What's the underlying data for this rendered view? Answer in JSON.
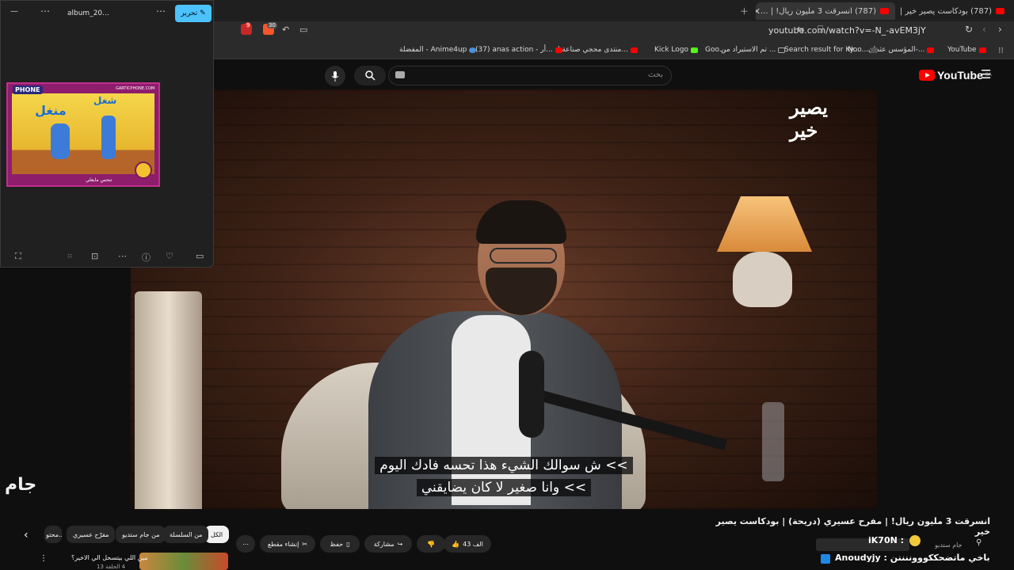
{
  "browser": {
    "tabs": [
      {
        "label": "(787) انسرقت 3 مليون ريال! | ...",
        "active": true
      },
      {
        "label": "(787) بودكاست يصير خير | ما أقدر أقول...",
        "active": false
      }
    ],
    "url": "youtube.com/watch?v=-N_-avEM3jY",
    "ext_badge_1": "9",
    "ext_badge_2": "30",
    "bookmarks": [
      {
        "label": "YouTube",
        "color": "#ff0000"
      },
      {
        "label": "المؤسس عثمان-...",
        "color": "#ff0000"
      },
      {
        "label": "Noo...",
        "color": "#555555"
      },
      {
        "label": "Search result for Ky...",
        "color": "#777777"
      },
      {
        "label": "تم الاستيراد من ...",
        "color": "#888888"
      },
      {
        "label": "Goo...",
        "color": "#888888"
      },
      {
        "label": "Kick Logo",
        "color": "#53fc18"
      },
      {
        "label": "منتدى محجي صناعة ا...",
        "color": "#ff0000"
      },
      {
        "label": "(37) anas action - أر...",
        "color": "#ff0000"
      },
      {
        "label": "المفضلة - Anime4up",
        "color": "#4a90e2"
      }
    ]
  },
  "youtube": {
    "logo_text": "YouTube",
    "logo_region": "SA",
    "search_placeholder": "بحث",
    "search_value": "",
    "video": {
      "watermark": "يصير خير",
      "subtitle_1": ">> ش سوالك الشيء هذا تحسه فادك اليوم",
      "subtitle_2": ">> وانا صغير لا كان يضايقني"
    },
    "title": "انسرقت 3 مليون ريال! | مفرح عسيري (دريحة) | بودكاست يصير خير",
    "likes": "43 الف",
    "actions": {
      "share": "مشاركة",
      "save": "حفظ",
      "clip": "إنشاء مقطع"
    },
    "chips": [
      "الكل",
      "من السلسلة",
      "من جام ستديو",
      "مفرّح عسيري",
      "محتو..."
    ],
    "channel_name": "جام ستديو",
    "recommendation_title": "مين اللي بيتسحل الي الاخير؟",
    "recommendation_sub": "4 الحلقة 13"
  },
  "chat": {
    "line_1": "iK70N :",
    "line_2": "Anoudyjy : باخي ماتضحككوووننننن"
  },
  "photos_app": {
    "title": "album_20...",
    "edit_label": "تحرير",
    "thumb_text_1": "منغل",
    "thumb_text_2": "شغل",
    "thumb_logo": "PHONE",
    "thumb_caption": "GARTICPHONE.COM",
    "thumb_footer": "تنحس مايعلي"
  },
  "side_watermark": "جام"
}
